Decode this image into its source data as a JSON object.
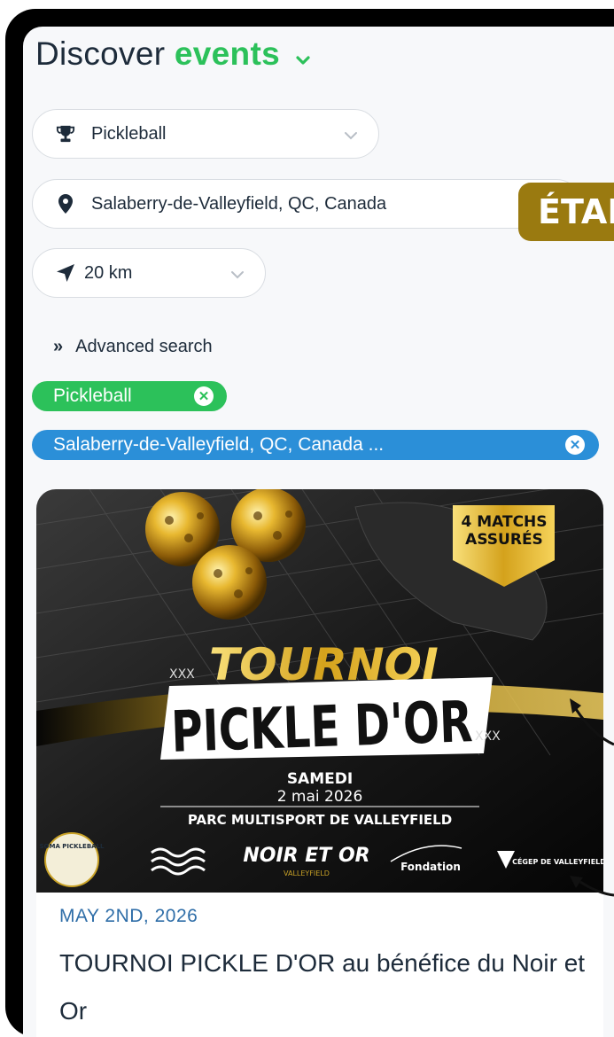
{
  "header": {
    "title_prefix": "Discover",
    "title_accent": "events"
  },
  "filters": {
    "sport": {
      "value": "Pickleball",
      "icon": "trophy-icon"
    },
    "location": {
      "value": "Salaberry-de-Valleyfield, QC, Canada",
      "icon": "map-pin-icon"
    },
    "radius": {
      "value": "20 km",
      "icon": "navigation-arrow-icon"
    },
    "advanced": {
      "label": "Advanced search",
      "icon": "double-chevron-right-icon"
    }
  },
  "active_tags": [
    {
      "label": "Pickleball",
      "color": "#2cc15a"
    },
    {
      "label": "Salaberry-de-Valleyfield, QC, Canada ...",
      "color": "#2b8fd8"
    }
  ],
  "overlay_badge": {
    "text": "ÉTAI",
    "color": "#9a7a10"
  },
  "event": {
    "poster": {
      "corner_banner": [
        "4 MATCHS",
        "ASSURÉS"
      ],
      "title_line1": "TOURNOI",
      "title_line2": "PICKLE D'OR",
      "deco_left": "XXX",
      "deco_right": "XXX",
      "day": "SAMEDI",
      "date": "2 mai 2026",
      "venue": "PARC MULTISPORT DE VALLEYFIELD",
      "sponsors": [
        "SOMA PICKLEBALL",
        "NOIR ET OR",
        "VALLEYFIELD",
        "Fondation",
        "CÉGEP DE VALLEYFIELD"
      ]
    },
    "date": "MAY 2ND, 2026",
    "title": "TOURNOI PICKLE D'OR au bénéfice du Noir et Or"
  },
  "colors": {
    "accent_green": "#2cc15a",
    "accent_blue": "#2b8fd8",
    "date_blue": "#2f6ea8",
    "gold": "#c9a227"
  }
}
